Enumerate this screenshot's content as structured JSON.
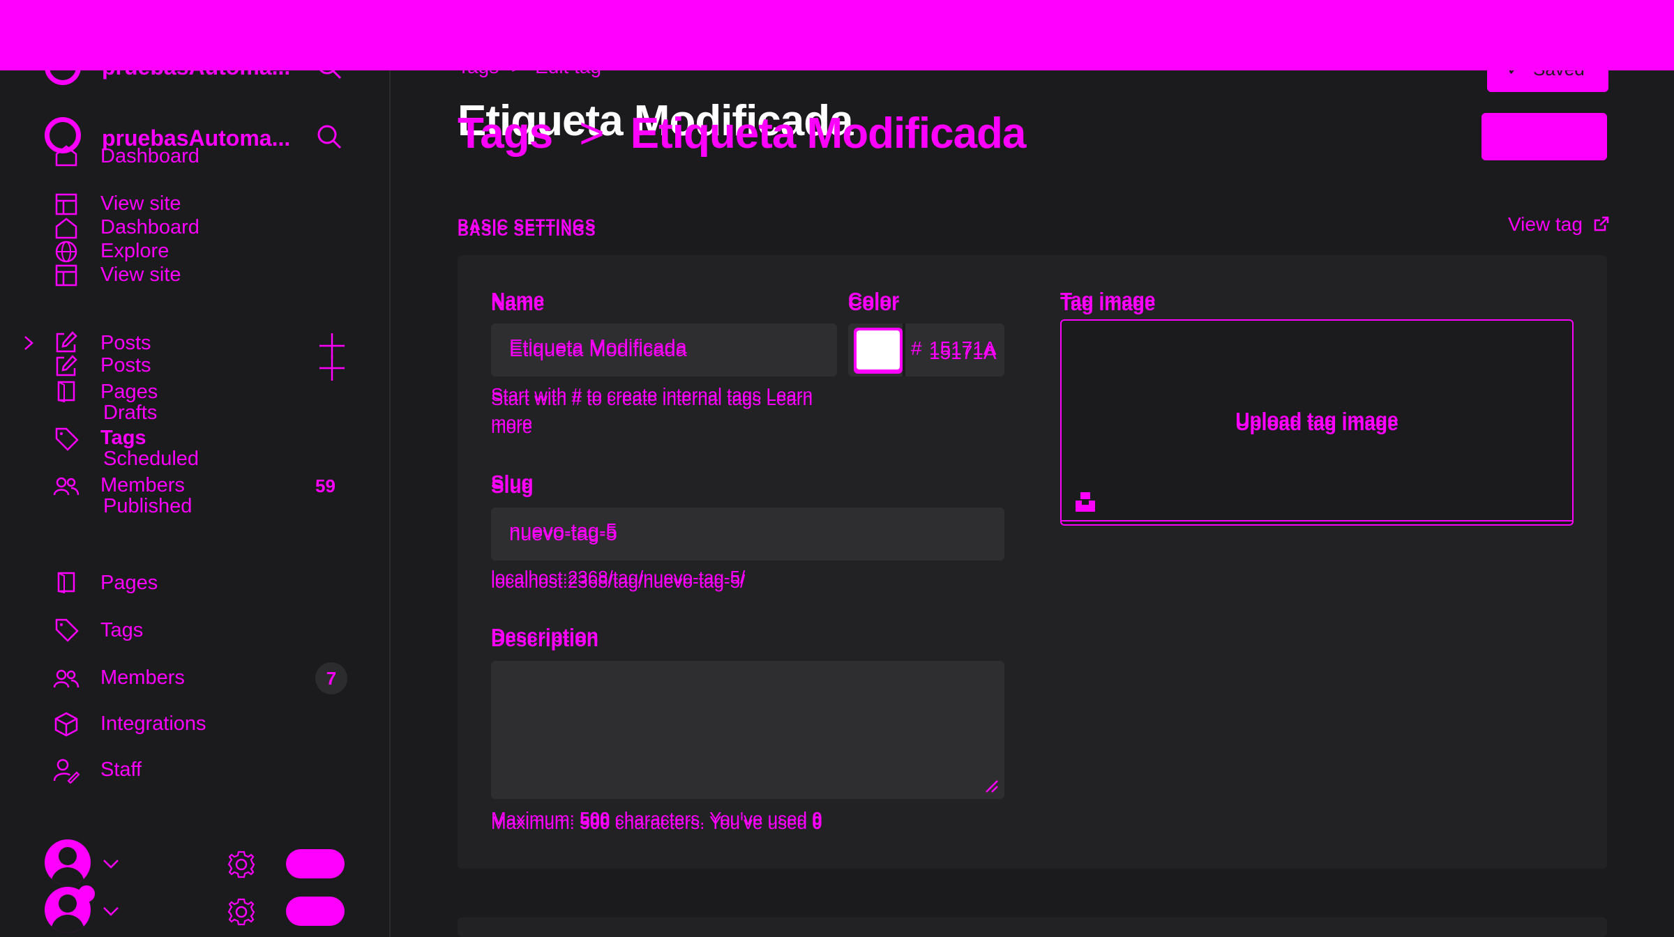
{
  "sidebar": {
    "site_title": "pruebasAutoma...",
    "site_title_ghost": "pruebasAutoma...",
    "nav_top": [
      {
        "label": "Dashboard"
      },
      {
        "label": "View site"
      },
      {
        "label": "Dashboard"
      },
      {
        "label": "Explore"
      },
      {
        "label": "View site"
      }
    ],
    "posts_label": "Posts",
    "posts_label_2": "Posts",
    "posts_sub": [
      {
        "label": "Drafts"
      },
      {
        "label": "Scheduled"
      },
      {
        "label": "Published"
      }
    ],
    "overlay_items": [
      {
        "label": "Pages"
      },
      {
        "label": "Tags"
      },
      {
        "label": "Members",
        "count": "59"
      }
    ],
    "nav_main": [
      {
        "label": "Pages"
      },
      {
        "label": "Tags"
      },
      {
        "label": "Members",
        "count": "7"
      },
      {
        "label": "Integrations"
      },
      {
        "label": "Staff"
      }
    ]
  },
  "header": {
    "breadcrumb_parent": "Tags",
    "breadcrumb_separator": ">",
    "breadcrumb_current": "Edit tag",
    "save_status": "Saved",
    "title": "Etiqueta Modificada",
    "title_breadcrumb_parent": "Tags",
    "title_breadcrumb_current": "Etiqueta Modificada"
  },
  "section": {
    "heading": "BASIC SETTINGS",
    "view_tag_label": "View tag"
  },
  "form": {
    "name_label": "Name",
    "name_value": "Etiqueta Modificada",
    "name_hint": "Start with # to create internal tags Learn more",
    "color_label": "Color",
    "color_hash": "#",
    "color_value": "15171A",
    "tag_image_label": "Tag image",
    "upload_label": "Upload tag image",
    "slug_label": "Slug",
    "slug_value": "nuevo-tag-5",
    "slug_url": "localhost:2368/tag/nuevo-tag-5/",
    "description_label": "Description",
    "description_hint_prefix": "Maximum:",
    "description_max": "500",
    "description_hint_middle": "characters. You've used",
    "description_used": "0"
  },
  "colors": {
    "accent": "#ff00ff",
    "background": "#1b1b1d",
    "card": "#222224",
    "input": "#2e2e30"
  }
}
